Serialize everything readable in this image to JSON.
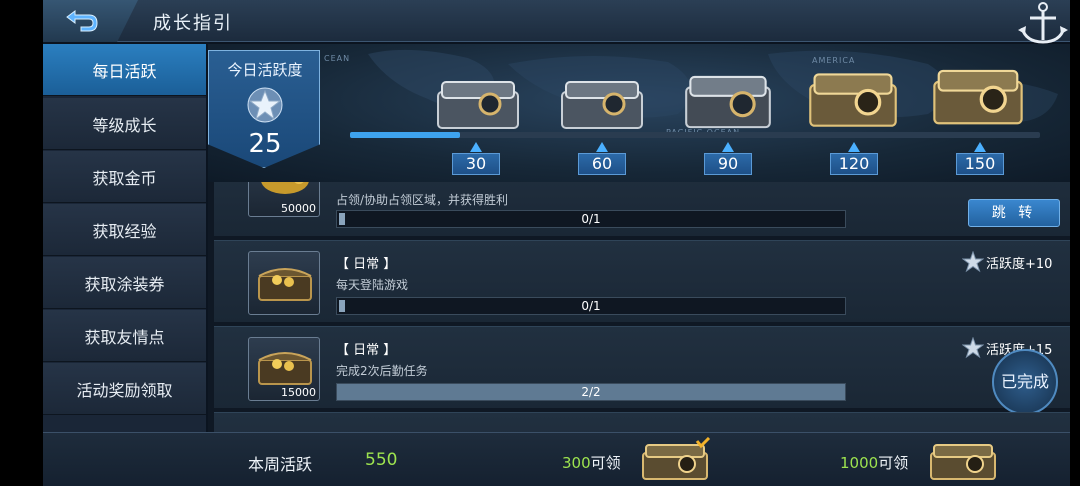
{
  "header": {
    "title": "成长指引"
  },
  "sidebar": {
    "items": [
      {
        "label": "每日活跃",
        "active": true
      },
      {
        "label": "等级成长",
        "active": false
      },
      {
        "label": "获取金币",
        "active": false
      },
      {
        "label": "获取经验",
        "active": false
      },
      {
        "label": "获取涂装券",
        "active": false
      },
      {
        "label": "获取友情点",
        "active": false
      },
      {
        "label": "活动奖励领取",
        "active": false
      }
    ]
  },
  "today": {
    "label": "今日活跃度",
    "value": "25",
    "progress_fraction": 0.16
  },
  "map_labels": [
    "CEAN",
    "PACIFIC OCEAN",
    "AMERICA"
  ],
  "milestones": [
    "30",
    "60",
    "90",
    "120",
    "150"
  ],
  "tasks": [
    {
      "tag": "",
      "desc": "占领/协助占领区域，并获得胜利",
      "progress": "0/1",
      "progress_fraction": 0.0,
      "reward_amount": "50000",
      "reward_activity": "",
      "action": "跳 转"
    },
    {
      "tag": "【 日常 】",
      "desc": "每天登陆游戏",
      "progress": "0/1",
      "progress_fraction": 0.0,
      "reward_amount": "",
      "reward_activity": "活跃度+10",
      "action": ""
    },
    {
      "tag": "【 日常 】",
      "desc": "完成2次后勤任务",
      "progress": "2/2",
      "progress_fraction": 1.0,
      "reward_amount": "15000",
      "reward_activity": "活跃度+15",
      "action": "已完成"
    }
  ],
  "weekly": {
    "label": "本周活跃",
    "value": "550",
    "goals": [
      {
        "num": "300",
        "suffix": "可领"
      },
      {
        "num": "1000",
        "suffix": "可领"
      }
    ]
  },
  "colors": {
    "accent": "#2b7fc0",
    "green_value": "#9de34f",
    "progress": "#3ea3ee"
  }
}
